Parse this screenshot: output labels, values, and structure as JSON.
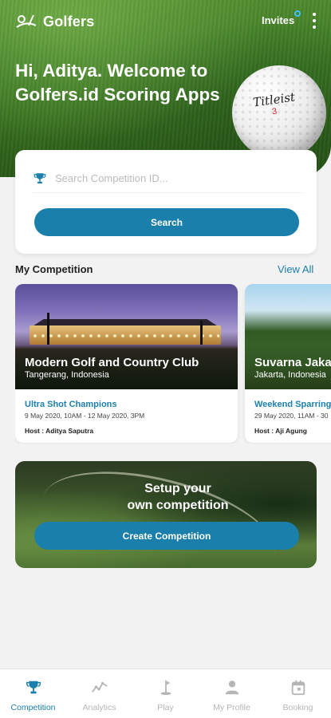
{
  "header": {
    "brand": "Golfers",
    "invites_label": "Invites",
    "greeting": "Hi, Aditya. Welcome to Golfers.id Scoring Apps",
    "ball_text": "Titleist",
    "ball_number": "3"
  },
  "search": {
    "placeholder": "Search Competition ID...",
    "button_label": "Search"
  },
  "my_competition": {
    "title": "My Competition",
    "view_all": "View All",
    "cards": [
      {
        "club": "Modern Golf and Country Club",
        "location": "Tangerang, Indonesia",
        "event": "Ultra Shot Champions",
        "dates": "9 May 2020, 10AM - 12 May 2020, 3PM",
        "host": "Host : Aditya Saputra"
      },
      {
        "club": "Suvarna Jakarta",
        "location": "Jakarta, Indonesia",
        "event": "Weekend Sparring",
        "dates": "29 May 2020, 11AM - 30",
        "host": "Host : Aji Agung"
      }
    ]
  },
  "setup": {
    "title_line1": "Setup your",
    "title_line2": "own competition",
    "button_label": "Create Competition"
  },
  "bottom_nav": [
    {
      "label": "Competition",
      "icon": "trophy-icon",
      "active": true
    },
    {
      "label": "Analytics",
      "icon": "analytics-icon",
      "active": false
    },
    {
      "label": "Play",
      "icon": "golf-flag-icon",
      "active": false
    },
    {
      "label": "My Profile",
      "icon": "person-icon",
      "active": false
    },
    {
      "label": "Booking",
      "icon": "calendar-icon",
      "active": false
    }
  ],
  "colors": {
    "accent": "#1b7fab",
    "inactive": "#b5b5b5",
    "invite_dot": "#39c2ff"
  }
}
